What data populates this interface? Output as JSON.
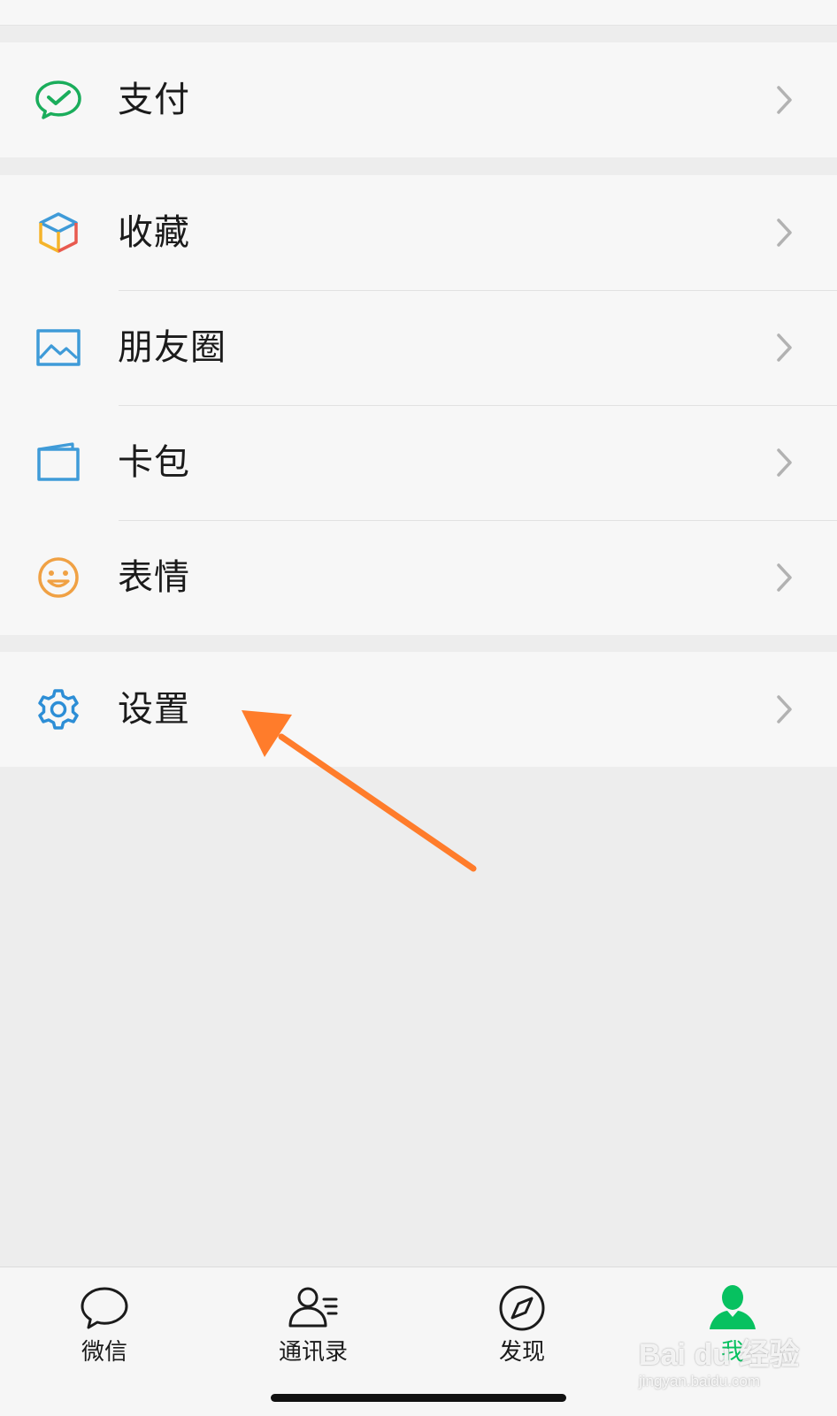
{
  "menu": {
    "pay": {
      "label": "支付",
      "icon": "wechat-pay-icon"
    },
    "favorites": {
      "label": "收藏",
      "icon": "favorites-cube-icon"
    },
    "moments": {
      "label": "朋友圈",
      "icon": "moments-picture-icon"
    },
    "cards": {
      "label": "卡包",
      "icon": "card-wallet-icon"
    },
    "stickers": {
      "label": "表情",
      "icon": "smiley-face-icon"
    },
    "settings": {
      "label": "设置",
      "icon": "gear-icon"
    }
  },
  "tabbar": {
    "chats": {
      "label": "微信",
      "icon": "chat-bubble-icon"
    },
    "contacts": {
      "label": "通讯录",
      "icon": "contacts-icon"
    },
    "discover": {
      "label": "发现",
      "icon": "compass-icon"
    },
    "me": {
      "label": "我",
      "icon": "person-icon",
      "active": true
    }
  },
  "watermark": {
    "main": "Bai du 经验",
    "sub": "jingyan.baidu.com"
  },
  "colors": {
    "accent_green": "#07c160",
    "annotation_arrow": "#ff7c2b",
    "settings_blue": "#2d8ed6",
    "background": "#ededed",
    "cell_background": "#f7f7f7"
  }
}
